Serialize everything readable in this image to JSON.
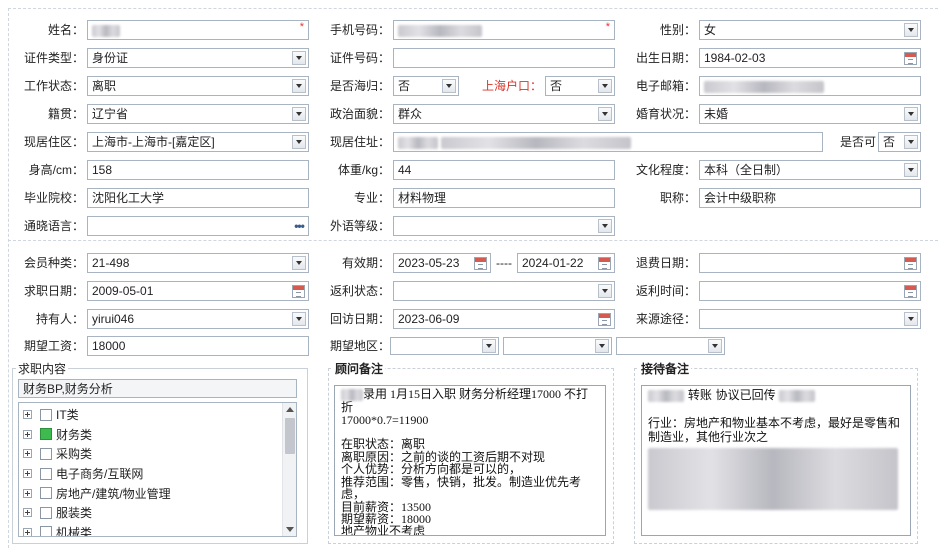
{
  "row1": {
    "name_label": "姓名：",
    "name_value": "",
    "phone_label": "手机号码：",
    "phone_value": "",
    "gender_label": "性别：",
    "gender_value": "女"
  },
  "row2": {
    "idtype_label": "证件类型：",
    "idtype_value": "身份证",
    "idno_label": "证件号码：",
    "idno_value": "",
    "birth_label": "出生日期：",
    "birth_value": "1984-02-03"
  },
  "row3": {
    "workstatus_label": "工作状态：",
    "workstatus_value": "离职",
    "returnee_label": "是否海归：",
    "returnee_value": "否",
    "shanghai_label": "上海户口：",
    "shanghai_value": "否",
    "email_label": "电子邮箱：",
    "email_value": ""
  },
  "row4": {
    "hometown_label": "籍贯：",
    "hometown_value": "辽宁省",
    "political_label": "政治面貌：",
    "political_value": "群众",
    "marital_label": "婚育状况：",
    "marital_value": "未婚"
  },
  "row5": {
    "residence_label": "现居住区：",
    "residence_value": "上海市-上海市-[嘉定区]",
    "address_label": "现居住址：",
    "address_value": "",
    "isok_label": "是否可",
    "isok_value": "否"
  },
  "row6": {
    "height_label": "身高/cm：",
    "height_value": "158",
    "weight_label": "体重/kg：",
    "weight_value": "44",
    "education_label": "文化程度：",
    "education_value": "本科（全日制）"
  },
  "row7": {
    "school_label": "毕业院校：",
    "school_value": "沈阳化工大学",
    "major_label": "专业：",
    "major_value": "材料物理",
    "title_label": "职称：",
    "title_value": "会计中级职称"
  },
  "row8": {
    "language_label": "通晓语言：",
    "language_value": "",
    "foreign_label": "外语等级：",
    "foreign_value": ""
  },
  "row9": {
    "membertype_label": "会员种类：",
    "membertype_value": "21-498",
    "validity_label": "有效期：",
    "validity_start": "2023-05-23",
    "validity_sep": "----",
    "validity_end": "2024-01-22",
    "refund_label": "退费日期：",
    "refund_value": ""
  },
  "row10": {
    "jobdate_label": "求职日期：",
    "jobdate_value": "2009-05-01",
    "rebate_label": "返利状态：",
    "rebate_value": "",
    "rebatetime_label": "返利时间：",
    "rebatetime_value": ""
  },
  "row11": {
    "holder_label": "持有人：",
    "holder_value": "yirui046",
    "visit_label": "回访日期：",
    "visit_value": "2023-06-09",
    "source_label": "来源途径：",
    "source_value": ""
  },
  "row12": {
    "salary_label": "期望工资：",
    "salary_value": "18000",
    "region_label": "期望地区：",
    "region_values": [
      "",
      "",
      ""
    ]
  },
  "job_content": {
    "title": "求职内容",
    "selected": "财务BP,财务分析",
    "items": [
      {
        "label": "IT类",
        "checked": false
      },
      {
        "label": "财务类",
        "checked": true
      },
      {
        "label": "采购类",
        "checked": false
      },
      {
        "label": "电子商务/互联网",
        "checked": false
      },
      {
        "label": "房地产/建筑/物业管理",
        "checked": false
      },
      {
        "label": "服装类",
        "checked": false
      },
      {
        "label": "机械类",
        "checked": false
      }
    ]
  },
  "advisor_notes": {
    "title": "顾问备注",
    "line1_after_blur": "录用 1月15日入职 财务分析经理17000 不打折",
    "body": "17000*0.7=11900\n\n在职状态：离职\n离职原因：之前的谈的工资后期不对现\n个人优势：分析方向都是可以的，\n推荐范围：零售，快销，批发。制造业优先考虑，\n目前薪资：13500\n期望薪资：18000\n地产物业不考虑"
  },
  "reception_notes": {
    "title": "接待备注",
    "line1_mid": "转账 协议已回传",
    "body": "行业：房地产和物业基本不考虑，最好是零售和制造业，其他行业次之"
  },
  "icons": {
    "dropdown": "chevron-down-icon",
    "calendar": "calendar-icon",
    "more": "ellipsis-icon",
    "expand": "plus-icon",
    "required": "asterisk-icon"
  },
  "colors": {
    "required_star": "#e33333",
    "shanghai_label": "#d9342b",
    "checked_box": "#3dbb4f",
    "field_border": "#a9b4c2"
  }
}
